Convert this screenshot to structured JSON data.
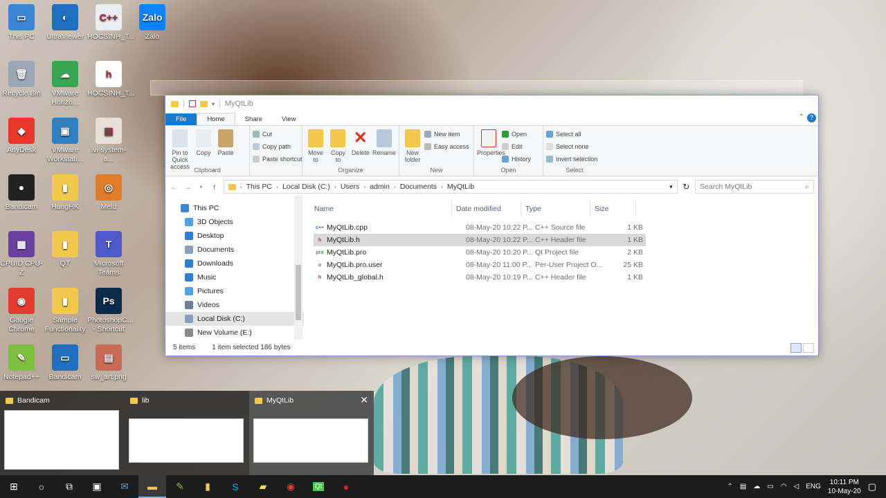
{
  "desktop": {
    "icons": [
      {
        "label": "This PC",
        "color": "#3a86d4",
        "glyph": "▭"
      },
      {
        "label": "UltraViewer",
        "color": "#1f6fbf",
        "glyph": "◐"
      },
      {
        "label": "HOCSINH_T...",
        "color": "#e9eef5",
        "glyph": "C++"
      },
      {
        "label": "Zalo",
        "color": "#0a84ff",
        "glyph": "Zalo"
      },
      {
        "label": "Recycle Bin",
        "color": "#9aa8b5",
        "glyph": "🗑"
      },
      {
        "label": "VMware Horizo...",
        "color": "#3aa655",
        "glyph": "☁"
      },
      {
        "label": "HOCSINH_T...",
        "color": "#ffffff",
        "glyph": "h"
      },
      {
        "label": "AnyDesk",
        "color": "#e8372d",
        "glyph": "◆"
      },
      {
        "label": "VMware Workstati...",
        "color": "#2f7fc1",
        "glyph": "▣"
      },
      {
        "label": "ivi-system-a...",
        "color": "#e8e0d8",
        "glyph": "▤"
      },
      {
        "label": "Bandicam",
        "color": "#222222",
        "glyph": "●"
      },
      {
        "label": "HungHK",
        "color": "#f2c94c",
        "glyph": "▮"
      },
      {
        "label": "Meld",
        "color": "#e07b2a",
        "glyph": "◎"
      },
      {
        "label": "CPUID CPU-Z",
        "color": "#6b3fa0",
        "glyph": "▦"
      },
      {
        "label": "QT",
        "color": "#f2c94c",
        "glyph": "▮"
      },
      {
        "label": "Microsoft Teams",
        "color": "#5059c9",
        "glyph": "T"
      },
      {
        "label": "Google Chrome",
        "color": "#e33b2e",
        "glyph": "◉"
      },
      {
        "label": "Sample Functionality",
        "color": "#f2c94c",
        "glyph": "▮"
      },
      {
        "label": "PhotoshopC... - Shortcut",
        "color": "#0a2a4a",
        "glyph": "Ps"
      },
      {
        "label": "Notepad++",
        "color": "#7fbf3f",
        "glyph": "✎"
      },
      {
        "label": "Bandicam",
        "color": "#1f6fbf",
        "glyph": "▭"
      },
      {
        "label": "sw_art.png",
        "color": "#c86a55",
        "glyph": "▤"
      }
    ]
  },
  "explorer": {
    "title": "MyQtLib",
    "tabs": [
      "File",
      "Home",
      "Share",
      "View"
    ],
    "ribbon": {
      "clipboard": {
        "pin": "Pin to Quick access",
        "copy": "Copy",
        "paste": "Paste",
        "cut": "Cut",
        "copy_path": "Copy path",
        "paste_shortcut": "Paste shortcut",
        "group": "Clipboard"
      },
      "organize": {
        "move_to": "Move to",
        "copy_to": "Copy to",
        "delete": "Delete",
        "rename": "Rename",
        "group": "Organize"
      },
      "new": {
        "new_folder": "New folder",
        "new_item": "New item",
        "easy_access": "Easy access",
        "group": "New"
      },
      "open": {
        "properties": "Properties",
        "open": "Open",
        "edit": "Edit",
        "history": "History",
        "group": "Open"
      },
      "select": {
        "select_all": "Select all",
        "select_none": "Select none",
        "invert": "Invert selection",
        "group": "Select"
      }
    },
    "path": [
      "This PC",
      "Local Disk (C:)",
      "Users",
      "admin",
      "Documents",
      "MyQtLib"
    ],
    "search_placeholder": "Search MyQtLib",
    "nav": [
      {
        "label": "This PC",
        "color": "#3a86d4"
      },
      {
        "label": "3D Objects",
        "color": "#4fa3e0"
      },
      {
        "label": "Desktop",
        "color": "#2f7fd1"
      },
      {
        "label": "Documents",
        "color": "#8aa0b8"
      },
      {
        "label": "Downloads",
        "color": "#2f7fd1"
      },
      {
        "label": "Music",
        "color": "#2f7fd1"
      },
      {
        "label": "Pictures",
        "color": "#4fa3e0"
      },
      {
        "label": "Videos",
        "color": "#6b7f95"
      },
      {
        "label": "Local Disk (C:)",
        "color": "#8aa0b8"
      },
      {
        "label": "New Volume (E:)",
        "color": "#8a8a8a"
      }
    ],
    "columns": {
      "name": "Name",
      "date": "Date modified",
      "type": "Type",
      "size": "Size"
    },
    "files": [
      {
        "name": "MyQtLib.cpp",
        "date": "08-May-20 10:22 P...",
        "type": "C++ Source file",
        "size": "1 KB",
        "icon": "c++",
        "icolor": "#3a6fb0"
      },
      {
        "name": "MyQtLib.h",
        "date": "08-May-20 10:22 P...",
        "type": "C++ Header file",
        "size": "1 KB",
        "icon": "h",
        "icolor": "#b02a3a"
      },
      {
        "name": "MyQtLib.pro",
        "date": "08-May-20 10:20 P...",
        "type": "Qt Project file",
        "size": "2 KB",
        "icon": "pro",
        "icolor": "#41a63a"
      },
      {
        "name": "MyQtLib.pro.user",
        "date": "08-May-20 11:00 P...",
        "type": "Per-User Project O...",
        "size": "25 KB",
        "icon": "u",
        "icolor": "#7a4fa0"
      },
      {
        "name": "MyQtLib_global.h",
        "date": "08-May-20 10:19 P...",
        "type": "C++ Header file",
        "size": "1 KB",
        "icon": "h",
        "icolor": "#b02a3a"
      }
    ],
    "status": {
      "count": "5 items",
      "selection": "1 item selected  186 bytes"
    }
  },
  "alttab": [
    {
      "title": "Bandicam"
    },
    {
      "title": "lib"
    },
    {
      "title": "MyQtLib"
    }
  ],
  "taskbar": {
    "buttons": [
      {
        "name": "start-button",
        "glyph": "⊞",
        "color": "#ffffff"
      },
      {
        "name": "cortana-button",
        "glyph": "○",
        "color": "#ffffff"
      },
      {
        "name": "task-view-button",
        "glyph": "⧉",
        "color": "#ffffff"
      },
      {
        "name": "store-button",
        "glyph": "▣",
        "color": "#ffffff"
      },
      {
        "name": "mail-button",
        "glyph": "✉",
        "color": "#4aa3e8"
      },
      {
        "name": "explorer-button",
        "glyph": "▬",
        "color": "#f2c94c"
      },
      {
        "name": "notepadpp-button",
        "glyph": "✎",
        "color": "#7fbf3f"
      },
      {
        "name": "folder-button",
        "glyph": "▮",
        "color": "#f2c94c"
      },
      {
        "name": "skype-button",
        "glyph": "S",
        "color": "#00aff0"
      },
      {
        "name": "sticky-notes-button",
        "glyph": "▰",
        "color": "#f7e04a"
      },
      {
        "name": "chrome-button",
        "glyph": "◉",
        "color": "#e33b2e"
      },
      {
        "name": "qtcreator-button",
        "glyph": "Qt",
        "color": "#41cd52"
      },
      {
        "name": "bandicam-button",
        "glyph": "●",
        "color": "#e02020"
      }
    ],
    "lang": "ENG",
    "time": "10:11 PM",
    "date": "10-May-20"
  }
}
